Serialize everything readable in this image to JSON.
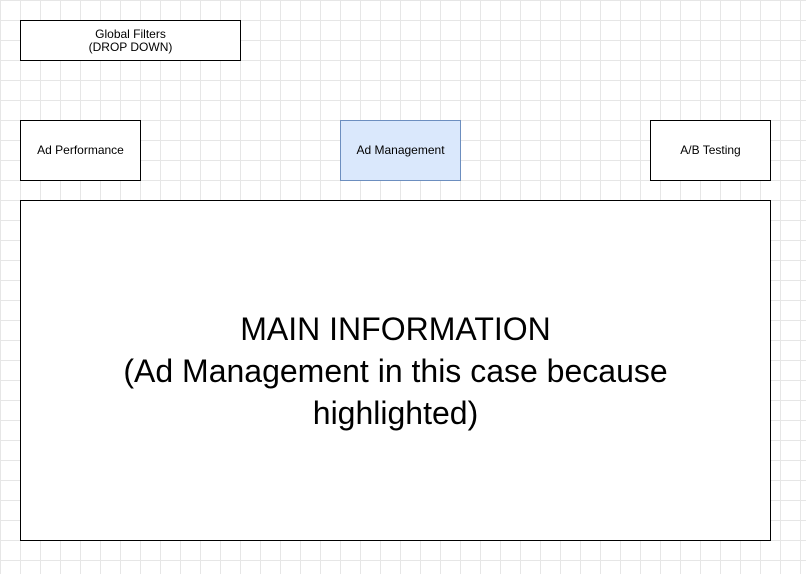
{
  "global_filters": {
    "line1": "Global Filters",
    "line2": "(DROP DOWN)"
  },
  "nav": {
    "ad_performance": "Ad Performance",
    "ad_management": "Ad Management",
    "ab_testing": "A/B Testing",
    "highlight_fill": "#dae8fc",
    "highlight_stroke": "#6c8ebf"
  },
  "main": {
    "line1": "MAIN INFORMATION",
    "line2": "(Ad Management in this case because",
    "line3": "highlighted)"
  }
}
